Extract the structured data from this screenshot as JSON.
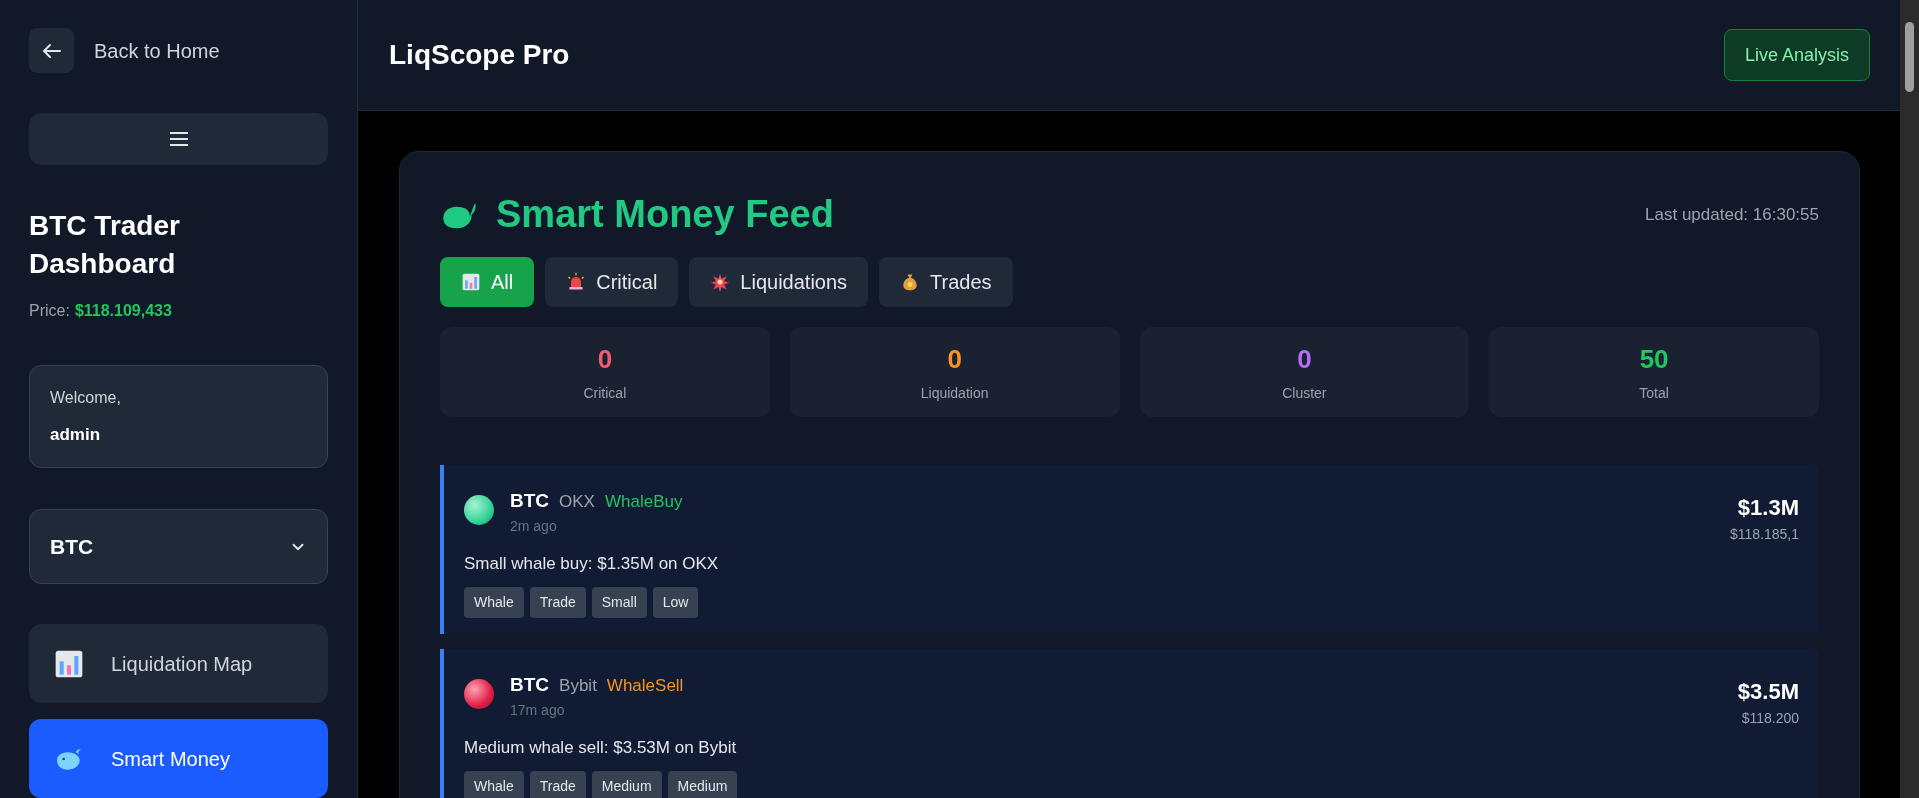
{
  "sidebar": {
    "back_label": "Back to Home",
    "title": "BTC Trader Dashboard",
    "price_label": "Price:",
    "price": "$118.109,433",
    "welcome": "Welcome,",
    "username": "admin",
    "asset_select": {
      "value": "BTC"
    },
    "nav": [
      {
        "label": "Liquidation Map",
        "kind": "chart",
        "selected": false
      },
      {
        "label": "Smart Money",
        "kind": "whale",
        "selected": true
      }
    ]
  },
  "header": {
    "title": "LiqScope Pro",
    "action": "Live Analysis"
  },
  "feed": {
    "title": "Smart Money Feed",
    "last_updated": "Last updated: 16:30:55",
    "filters": [
      {
        "label": "All",
        "kind": "chart",
        "selected": true
      },
      {
        "label": "Critical",
        "kind": "siren",
        "selected": false
      },
      {
        "label": "Liquidations",
        "kind": "burst",
        "selected": false
      },
      {
        "label": "Trades",
        "kind": "moneybag",
        "selected": false
      }
    ],
    "stats": [
      {
        "value": "0",
        "label": "Critical",
        "color": "#f05d6c"
      },
      {
        "value": "0",
        "label": "Liquidation",
        "color": "#f7931e"
      },
      {
        "value": "0",
        "label": "Cluster",
        "color": "#b46cf5"
      },
      {
        "value": "50",
        "label": "Total",
        "color": "#22c55e"
      }
    ],
    "items": [
      {
        "symbol": "BTC",
        "exchange": "OKX",
        "type": "WhaleBuy",
        "kind": "buy",
        "time": "2m ago",
        "description": "Small whale buy: $1.35M on OKX",
        "tags": [
          "Whale",
          "Trade",
          "Small",
          "Low"
        ],
        "amount": "$1.3M",
        "price": "$118.185,1"
      },
      {
        "symbol": "BTC",
        "exchange": "Bybit",
        "type": "WhaleSell",
        "kind": "sell",
        "time": "17m ago",
        "description": "Medium whale sell: $3.53M on Bybit",
        "tags": [
          "Whale",
          "Trade",
          "Medium",
          "Medium"
        ],
        "amount": "$3.5M",
        "price": "$118.200"
      }
    ]
  }
}
